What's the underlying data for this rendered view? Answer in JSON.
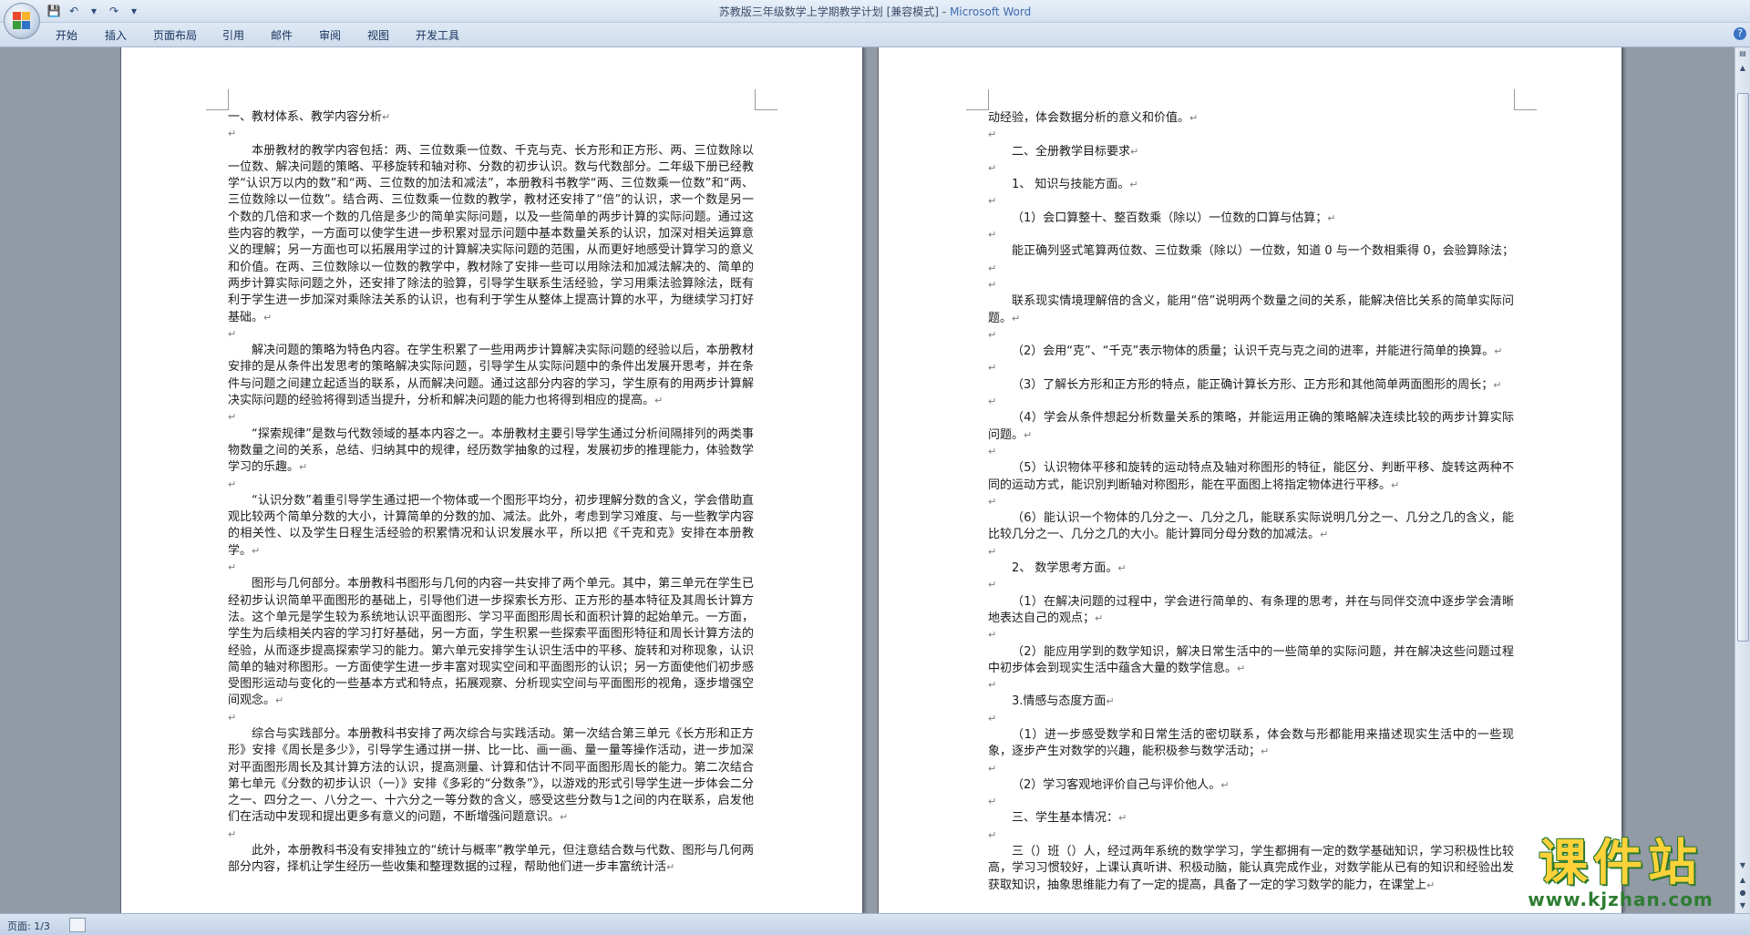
{
  "window": {
    "doc_title": "苏教版三年级数学上学期教学计划 [兼容模式]",
    "separator": " - ",
    "app_name": "Microsoft Word"
  },
  "ribbon": {
    "tabs": [
      "开始",
      "插入",
      "页面布局",
      "引用",
      "邮件",
      "审阅",
      "视图",
      "开发工具"
    ]
  },
  "status": {
    "page_info": "页面: 1/3"
  },
  "colors": {
    "office_logo": [
      "#e8492c",
      "#f7b32b",
      "#3c9b3b",
      "#2f74c9"
    ],
    "watermark_text": "#ffd23a",
    "watermark_url": "#2e7d32"
  },
  "watermark": {
    "title": "课件站",
    "url": "www.kjzhan.com"
  },
  "left_page": {
    "paragraphs": [
      {
        "text": "一、教材体系、教学内容分析",
        "indent": false
      },
      {
        "text": "",
        "indent": false
      },
      {
        "text": "本册教材的教学内容包括：两、三位数乘一位数、千克与克、长方形和正方形、两、三位数除以一位数、解决问题的策略、平移旋转和轴对称、分数的初步认识。数与代数部分。二年级下册已经教学“认识万以内的数”和“两、三位数的加法和减法”，本册教科书教学“两、三位数乘一位数”和“两、三位数除以一位数”。结合两、三位数乘一位数的教学，教材还安排了“倍”的认识，求一个数是另一个数的几倍和求一个数的几倍是多少的简单实际问题，以及一些简单的两步计算的实际问题。通过这些内容的教学，一方面可以使学生进一步积累对显示问题中基本数量关系的认识，加深对相关运算意义的理解；另一方面也可以拓展用学过的计算解决实际问题的范围，从而更好地感受计算学习的意义和价值。在两、三位数除以一位数的教学中，教材除了安排一些可以用除法和加减法解决的、简单的两步计算实际问题之外，还安排了除法的验算，引导学生联系生活经验，学习用乘法验算除法，既有利于学生进一步加深对乘除法关系的认识，也有利于学生从整体上提高计算的水平，为继续学习打好基础。",
        "indent": true
      },
      {
        "text": "",
        "indent": false
      },
      {
        "text": "解决问题的策略为特色内容。在学生积累了一些用两步计算解决实际问题的经验以后，本册教材安排的是从条件出发思考的策略解决实际问题，引导学生从实际问题中的条件出发展开思考，并在条件与问题之间建立起适当的联系，从而解决问题。通过这部分内容的学习，学生原有的用两步计算解决实际问题的经验将得到适当提升，分析和解决问题的能力也将得到相应的提高。",
        "indent": true
      },
      {
        "text": "",
        "indent": false
      },
      {
        "text": "“探索规律”是数与代数领域的基本内容之一。本册教材主要引导学生通过分析间隔排列的两类事物数量之间的关系，总结、归纳其中的规律，经历数学抽象的过程，发展初步的推理能力，体验数学学习的乐趣。",
        "indent": true
      },
      {
        "text": "",
        "indent": false
      },
      {
        "text": "“认识分数”着重引导学生通过把一个物体或一个图形平均分，初步理解分数的含义，学会借助直观比较两个简单分数的大小，计算简单的分数的加、减法。此外，考虑到学习难度、与一些教学内容的相关性、以及学生日程生活经验的积累情况和认识发展水平，所以把《千克和克》安排在本册教学。",
        "indent": true
      },
      {
        "text": "",
        "indent": false
      },
      {
        "text": "图形与几何部分。本册教科书图形与几何的内容一共安排了两个单元。其中，第三单元在学生已经初步认识简单平面图形的基础上，引导他们进一步探索长方形、正方形的基本特征及其周长计算方法。这个单元是学生较为系统地认识平面图形、学习平面图形周长和面积计算的起始单元。一方面，学生为后续相关内容的学习打好基础，另一方面，学生积累一些探索平面图形特征和周长计算方法的经验，从而逐步提高探索学习的能力。第六单元安排学生认识生活中的平移、旋转和对称现象，认识简单的轴对称图形。一方面使学生进一步丰富对现实空间和平面图形的认识；另一方面使他们初步感受图形运动与变化的一些基本方式和特点，拓展观察、分析现实空间与平面图形的视角，逐步增强空间观念。",
        "indent": true
      },
      {
        "text": "",
        "indent": false
      },
      {
        "text": "综合与实践部分。本册教科书安排了两次综合与实践活动。第一次结合第三单元《长方形和正方形》安排《周长是多少》，引导学生通过拼一拼、比一比、画一画、量一量等操作活动，进一步加深对平面图形周长及其计算方法的认识，提高测量、计算和估计不同平面图形周长的能力。第二次结合第七单元《分数的初步认识（一）》安排《多彩的“分数条”》，以游戏的形式引导学生进一步体会二分之一、四分之一、八分之一、十六分之一等分数的含义，感受这些分数与1之间的内在联系，启发他们在活动中发现和提出更多有意义的问题，不断增强问题意识。",
        "indent": true
      },
      {
        "text": "",
        "indent": false
      },
      {
        "text": "此外，本册教科书没有安排独立的“统计与概率”教学单元，但注意结合数与代数、图形与几何两部分内容，择机让学生经历一些收集和整理数据的过程，帮助他们进一步丰富统计活",
        "indent": true
      }
    ]
  },
  "right_page": {
    "paragraphs": [
      {
        "text": "动经验，体会数据分析的意义和价值。",
        "indent": false
      },
      {
        "text": "",
        "indent": false
      },
      {
        "text": "二、全册教学目标要求",
        "indent": true
      },
      {
        "text": "",
        "indent": false
      },
      {
        "text": "1、 知识与技能方面。",
        "indent": true
      },
      {
        "text": "",
        "indent": false
      },
      {
        "text": "（1）会口算整十、整百数乘（除以）一位数的口算与估算；",
        "indent": true
      },
      {
        "text": "",
        "indent": false
      },
      {
        "text": "能正确列竖式笔算两位数、三位数乘（除以）一位数，知道 0 与一个数相乘得 0，会验算除法；",
        "indent": true
      },
      {
        "text": "",
        "indent": false
      },
      {
        "text": "联系现实情境理解倍的含义，能用“倍”说明两个数量之间的关系，能解决倍比关系的简单实际问题。",
        "indent": true
      },
      {
        "text": "",
        "indent": false
      },
      {
        "text": "（2）会用“克”、“千克”表示物体的质量；认识千克与克之间的进率，并能进行简单的换算。",
        "indent": true
      },
      {
        "text": "",
        "indent": false
      },
      {
        "text": "（3）了解长方形和正方形的特点，能正确计算长方形、正方形和其他简单两面图形的周长；",
        "indent": true
      },
      {
        "text": "",
        "indent": false
      },
      {
        "text": "（4）学会从条件想起分析数量关系的策略，并能运用正确的策略解决连续比较的两步计算实际问题。",
        "indent": true
      },
      {
        "text": "",
        "indent": false
      },
      {
        "text": "（5）认识物体平移和旋转的运动特点及轴对称图形的特征，能区分、判断平移、旋转这两种不同的运动方式，能识別判断轴对称图形，能在平面图上将指定物体进行平移。",
        "indent": true
      },
      {
        "text": "",
        "indent": false
      },
      {
        "text": "（6）能认识一个物体的几分之一、几分之几，能联系实际说明几分之一、几分之几的含义，能比较几分之一、几分之几的大小。能计算同分母分数的加减法。",
        "indent": true
      },
      {
        "text": "",
        "indent": false
      },
      {
        "text": "2、 数学思考方面。",
        "indent": true
      },
      {
        "text": "",
        "indent": false
      },
      {
        "text": "（1）在解决问题的过程中，学会进行简单的、有条理的思考，并在与同伴交流中逐步学会清晰地表达自己的观点；",
        "indent": true
      },
      {
        "text": "",
        "indent": false
      },
      {
        "text": "（2）能应用学到的数学知识，解决日常生活中的一些简单的实际问题，并在解决这些问题过程中初步体会到现实生活中蕴含大量的数学信息。",
        "indent": true
      },
      {
        "text": "",
        "indent": false
      },
      {
        "text": "3.情感与态度方面",
        "indent": true
      },
      {
        "text": "",
        "indent": false
      },
      {
        "text": "（1）进一步感受数学和日常生活的密切联系，体会数与形都能用来描述现实生活中的一些现象，逐步产生对数学的兴趣，能积极参与数学活动；",
        "indent": true
      },
      {
        "text": "",
        "indent": false
      },
      {
        "text": "（2）学习客观地评价自己与评价他人。",
        "indent": true
      },
      {
        "text": "",
        "indent": false
      },
      {
        "text": "三、学生基本情况：",
        "indent": true
      },
      {
        "text": "",
        "indent": false
      },
      {
        "text": "三（）班（）人，经过两年系统的数学学习，学生都拥有一定的数学基础知识，学习积极性比较高，学习习惯较好，上课认真听讲、积极动脑，能认真完成作业，对数学能从已有的知识和经验出发获取知识，抽象思维能力有了一定的提高，具备了一定的学习数学的能力，在课堂上",
        "indent": true
      }
    ]
  }
}
